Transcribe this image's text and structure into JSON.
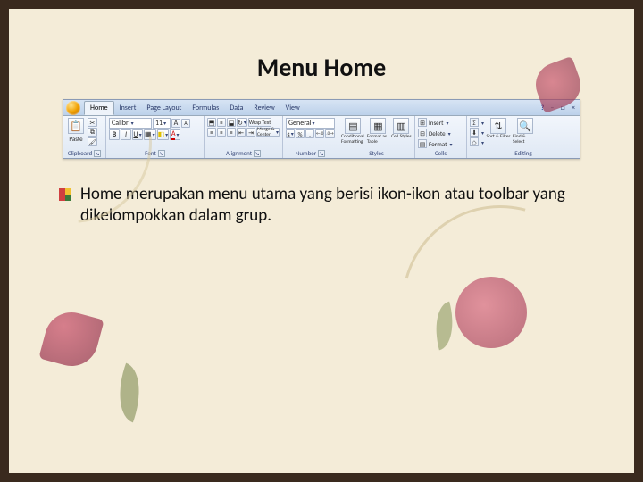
{
  "slide": {
    "title": "Menu Home",
    "paragraph": "Home merupakan menu utama yang berisi ikon-ikon atau toolbar yang dikelompokkan dalam grup."
  },
  "ribbon": {
    "tabs": [
      "Home",
      "Insert",
      "Page Layout",
      "Formulas",
      "Data",
      "Review",
      "View"
    ],
    "active_tab": "Home",
    "help_icon": "?",
    "window_buttons": [
      "–",
      "□",
      "×"
    ],
    "groups": {
      "clipboard": {
        "label": "Clipboard",
        "paste": "Paste",
        "cut_icon": "✂",
        "copy_icon": "⧉",
        "fmtpainter_icon": "🖌"
      },
      "font": {
        "label": "Font",
        "font_name": "Calibri",
        "font_size": "11",
        "bold": "B",
        "italic": "I",
        "underline": "U",
        "grow": "A",
        "shrink": "A",
        "border_icon": "▦",
        "fill_icon": "◧",
        "color_icon": "A"
      },
      "alignment": {
        "label": "Alignment",
        "top": "⬒",
        "mid": "≡",
        "bot": "⬓",
        "left": "≡",
        "center": "≡",
        "right": "≡",
        "indent_dec": "⇤",
        "indent_inc": "⇥",
        "wrap": "Wrap Text",
        "merge": "Merge & Center"
      },
      "number": {
        "label": "Number",
        "format": "General",
        "currency": "$",
        "percent": "%",
        "comma": ",",
        "inc_dec": "←.0",
        "dec_dec": ".0→"
      },
      "styles": {
        "label": "Styles",
        "cond": "Conditional Formatting",
        "table": "Format as Table",
        "cell": "Cell Styles"
      },
      "cells": {
        "label": "Cells",
        "insert": "Insert",
        "delete": "Delete",
        "format": "Format",
        "insert_icon": "⊞",
        "delete_icon": "⊟",
        "format_icon": "▤"
      },
      "editing": {
        "label": "Editing",
        "sum": "Σ",
        "fill": "⬇",
        "clear": "◇",
        "sort": "Sort & Filter",
        "find": "Find & Select"
      }
    }
  }
}
